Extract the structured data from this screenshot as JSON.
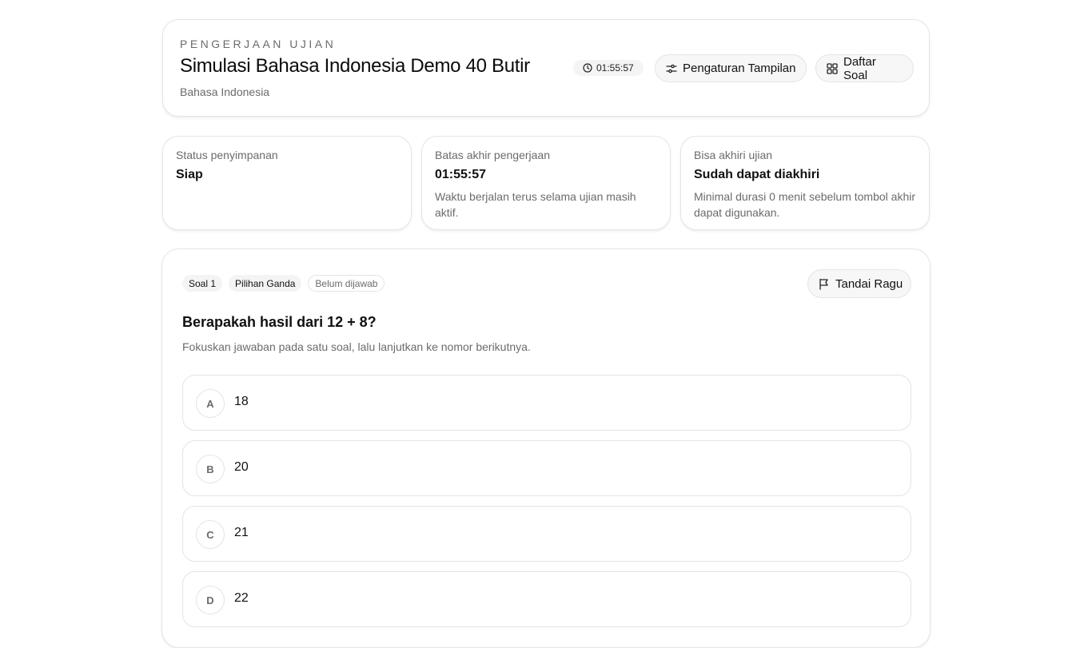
{
  "header": {
    "eyebrow": "PENGERJAAN UJIAN",
    "title": "Simulasi Bahasa Indonesia Demo 40 Butir",
    "subject": "Bahasa Indonesia",
    "timer": "01:55:57",
    "timer_icon": "clock-icon",
    "settings_label": "Pengaturan Tampilan",
    "settings_icon": "sliders-icon",
    "list_label": "Daftar Soal",
    "list_icon": "grid-icon"
  },
  "info": [
    {
      "label": "Status penyimpanan",
      "value": "Siap",
      "desc": ""
    },
    {
      "label": "Batas akhir pengerjaan",
      "value": "01:55:57",
      "desc": "Waktu berjalan terus selama ujian masih aktif."
    },
    {
      "label": "Bisa akhiri ujian",
      "value": "Sudah dapat diakhiri",
      "desc": "Minimal durasi 0 menit sebelum tombol akhir dapat digunakan."
    }
  ],
  "question": {
    "tags": [
      "Soal 1",
      "Pilihan Ganda",
      "Belum dijawab"
    ],
    "flag_label": "Tandai Ragu",
    "flag_icon": "flag-icon",
    "title": "Berapakah hasil dari 12 + 8?",
    "hint": "Fokuskan jawaban pada satu soal, lalu lanjutkan ke nomor berikutnya.",
    "options": [
      {
        "letter": "A",
        "text": "18"
      },
      {
        "letter": "B",
        "text": "20"
      },
      {
        "letter": "C",
        "text": "21"
      },
      {
        "letter": "D",
        "text": "22"
      }
    ]
  }
}
